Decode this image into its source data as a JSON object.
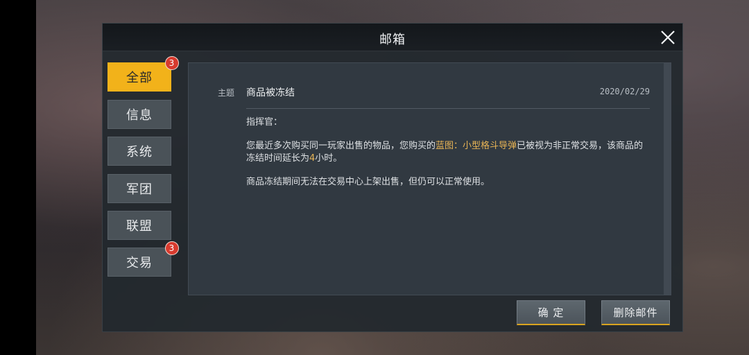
{
  "window": {
    "title": "邮箱"
  },
  "sidebar": {
    "tabs": [
      {
        "label": "全部",
        "active": true,
        "badge": "3"
      },
      {
        "label": "信息",
        "active": false,
        "badge": ""
      },
      {
        "label": "系统",
        "active": false,
        "badge": ""
      },
      {
        "label": "军团",
        "active": false,
        "badge": ""
      },
      {
        "label": "联盟",
        "active": false,
        "badge": ""
      },
      {
        "label": "交易",
        "active": false,
        "badge": "3"
      }
    ]
  },
  "mail": {
    "subject_key": "主题",
    "subject": "商品被冻结",
    "date": "2020/02/29",
    "greeting": "指挥官：",
    "para1_a": "您最近多次购买同一玩家出售的物品，您购买的",
    "para1_b": "蓝图：小型格斗导弹",
    "para1_c": "已被视为非正常交易，该商品的冻结时间延长为",
    "para1_d": "4",
    "para1_e": "小时。",
    "para2": "商品冻结期间无法在交易中心上架出售，但仍可以正常使用。"
  },
  "buttons": {
    "ok": "确 定",
    "delete": "删除邮件"
  },
  "colors": {
    "accent": "#f2b21a",
    "badge": "#d83a2e",
    "highlight": "#e8b455"
  }
}
